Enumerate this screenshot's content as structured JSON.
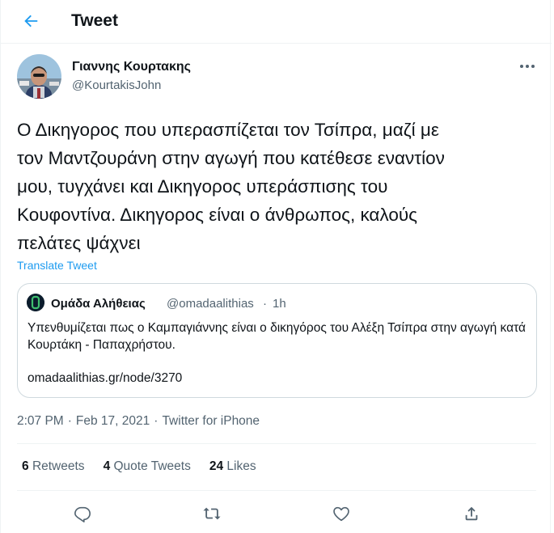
{
  "header": {
    "title": "Tweet",
    "back_icon": "arrow-left-icon",
    "accent": "#1d9bf0"
  },
  "author": {
    "name": "Γιαννης Κουρτακης",
    "handle": "@KourtakisJohn",
    "avatar_icon": "profile-photo"
  },
  "tweet": {
    "text": "Ο Δικηγορος που υπερασπίζεται τον Τσίπρα, μαζί με\nτον Μαντζουράνη στην αγωγή που κατέθεσε εναντίον\nμου, τυγχάνει και Δικηγορος υπεράσπισης του\nΚουφοντίνα. Δικηγορος είναι ο άνθρωπος, καλούς\nπελάτες ψάχνει",
    "translate_label": "Translate Tweet"
  },
  "quote": {
    "name": "Ομάδα Αλήθειας",
    "handle": "@omadaalithias",
    "separator": "·",
    "time": "1h",
    "text": "Υπενθυμίζεται πως ο Καμπαγιάννης είναι ο δικηγόρος του Αλέξη Τσίπρα στην αγωγή κατά Κουρτάκη - Παπαχρήστου.",
    "link": "omadaalithias.gr/node/3270"
  },
  "meta": {
    "time": "2:07 PM",
    "sep1": "·",
    "date": "Feb 17, 2021",
    "sep2": "·",
    "source": "Twitter for iPhone"
  },
  "stats": {
    "retweets_count": "6",
    "retweets_label": "Retweets",
    "quotes_count": "4",
    "quotes_label": "Quote Tweets",
    "likes_count": "24",
    "likes_label": "Likes"
  },
  "actions": [
    "reply-icon",
    "retweet-icon",
    "like-icon",
    "share-icon"
  ]
}
